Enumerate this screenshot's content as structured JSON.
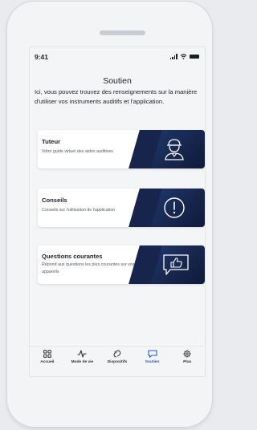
{
  "status_bar": {
    "time": "9:41"
  },
  "page": {
    "title": "Soutien",
    "intro": "Ici, vous pouvez trouvez des renseignements sur la manière d'utiliser vos instruments auditifs et l'application."
  },
  "cards": [
    {
      "title": "Tuteur",
      "description": "Votre guide virtuel des aides auditives",
      "icon": "tutor-person-icon"
    },
    {
      "title": "Conseils",
      "description": "Conseils sur l'utilisation de l'application",
      "icon": "exclamation-circle-icon"
    },
    {
      "title": "Questions courantes",
      "description": "Répond aux questions les plus courantes sur vos appareils",
      "icon": "thumbs-up-chat-icon"
    }
  ],
  "tabbar": {
    "items": [
      {
        "label": "Accueil",
        "icon": "grid-icon",
        "active": false
      },
      {
        "label": "Mode de vie",
        "icon": "pulse-icon",
        "active": false
      },
      {
        "label": "Dispositifs",
        "icon": "hearing-aid-icon",
        "active": false
      },
      {
        "label": "Soutien",
        "icon": "chat-bubble-icon",
        "active": true
      },
      {
        "label": "Plus",
        "icon": "gear-icon",
        "active": false
      }
    ]
  },
  "colors": {
    "card_accent": "#17254d",
    "active_tab": "#2a57c6"
  }
}
